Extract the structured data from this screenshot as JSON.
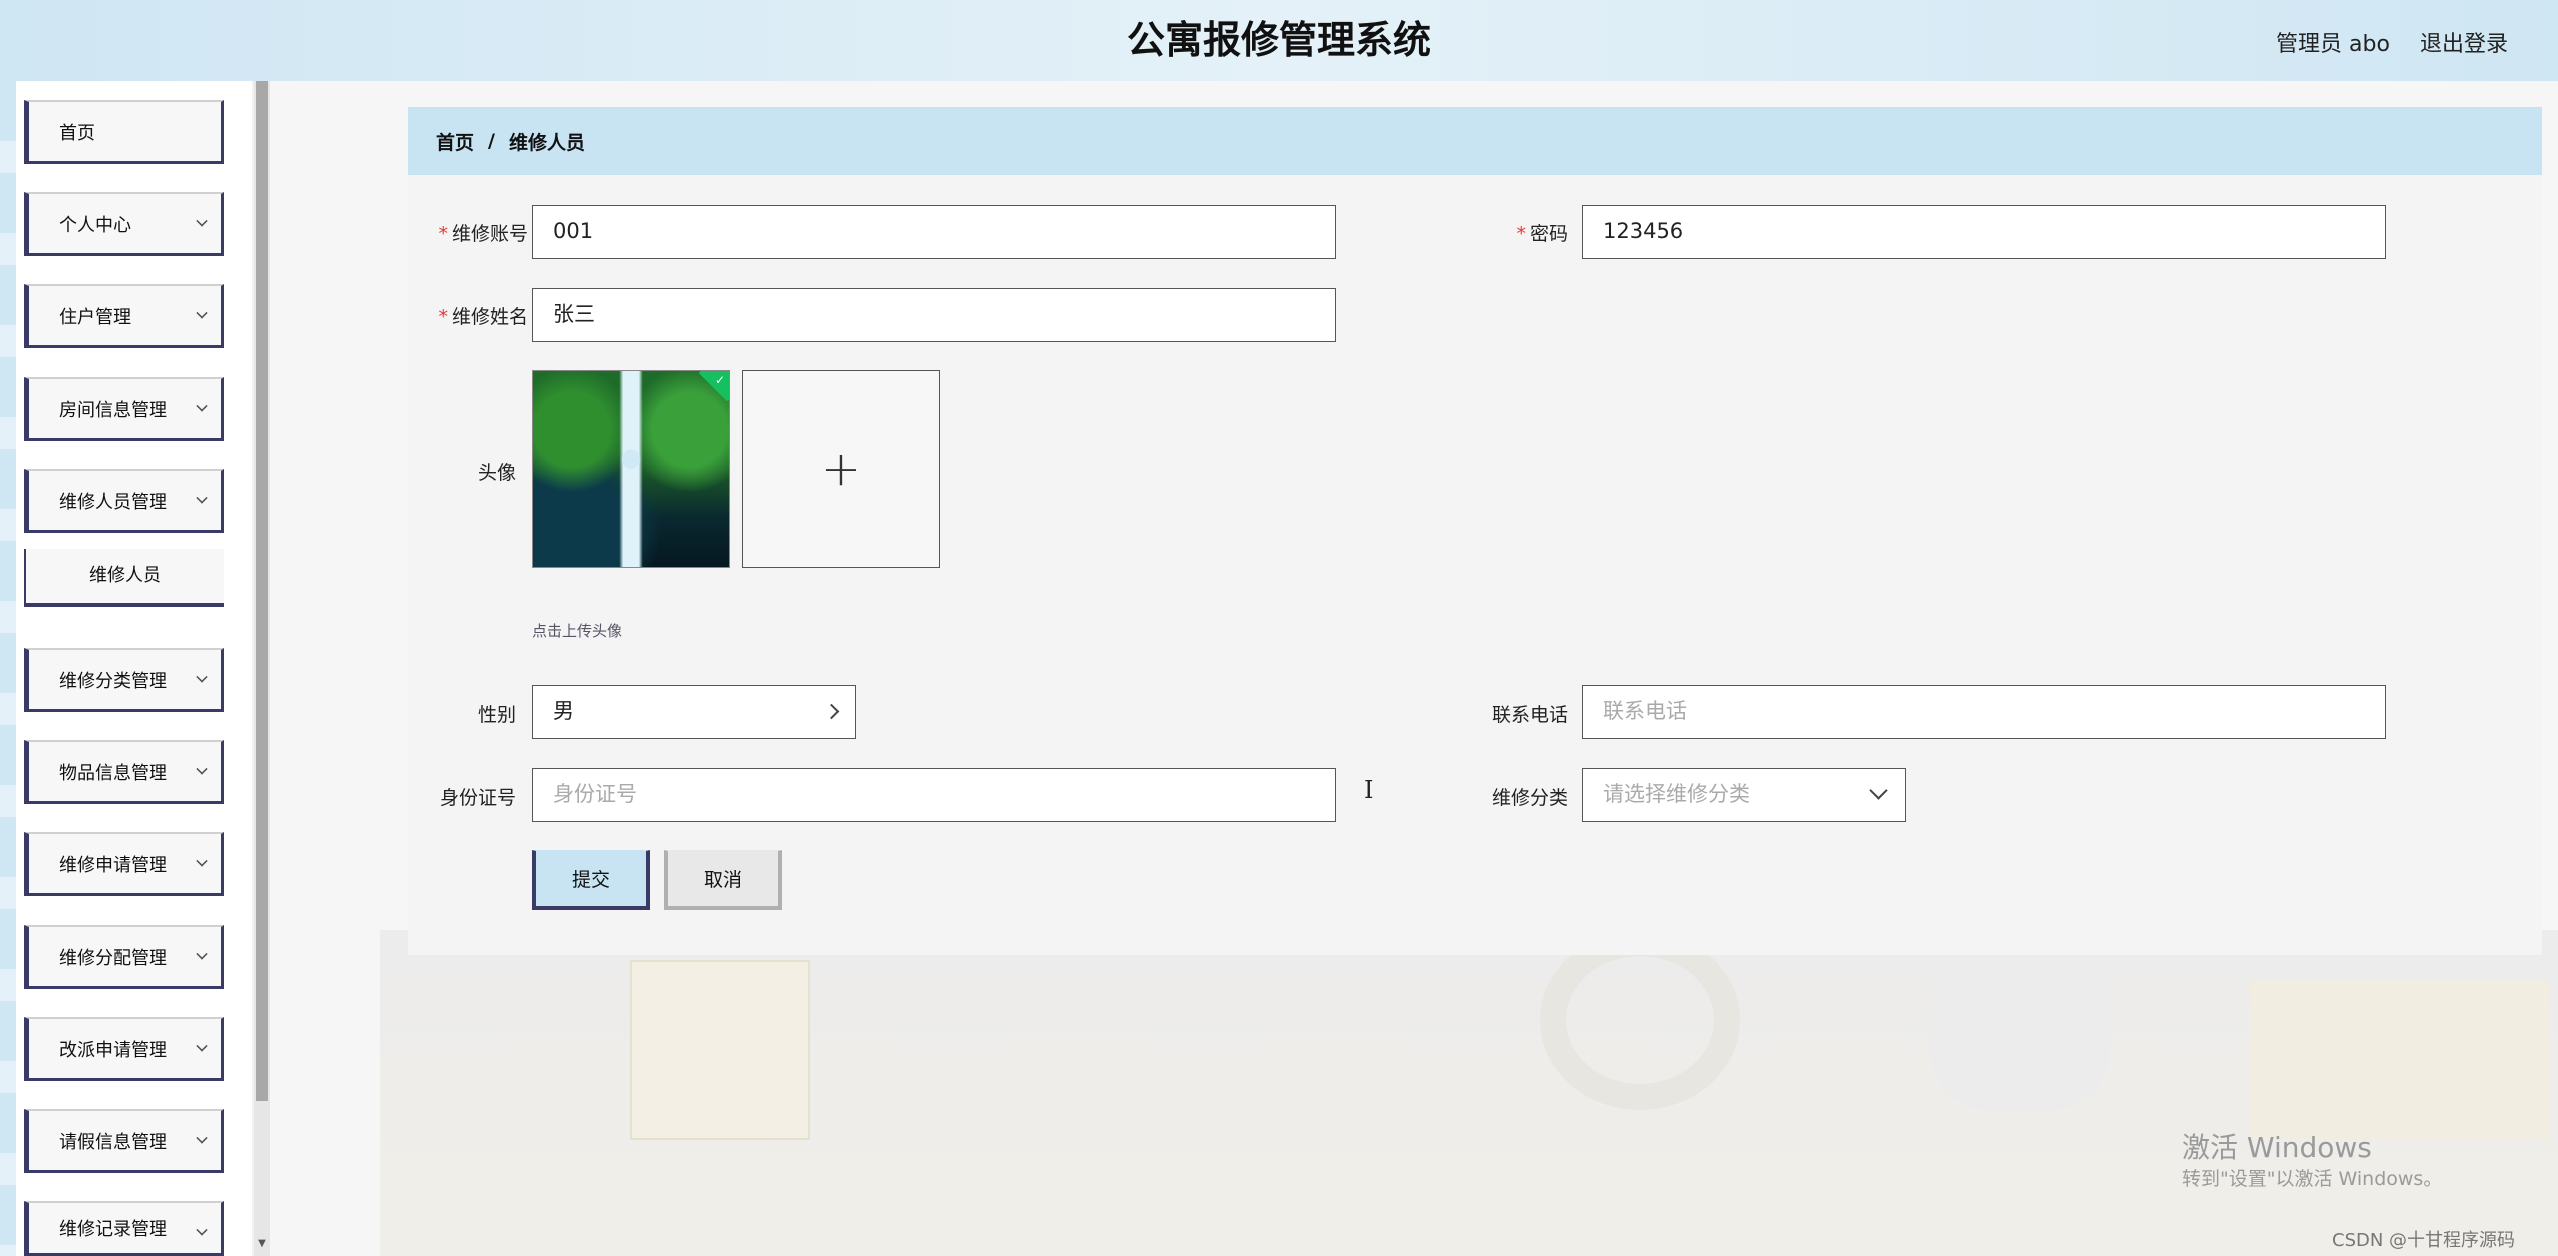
{
  "app": {
    "title": "公寓报修管理系统",
    "user_label": "管理员 abo",
    "logout": "退出登录"
  },
  "sidebar": {
    "items": [
      {
        "label": "首页"
      },
      {
        "label": "个人中心"
      },
      {
        "label": "住户管理"
      },
      {
        "label": "房间信息管理"
      },
      {
        "label": "维修人员管理"
      },
      {
        "label": "维修人员"
      },
      {
        "label": "维修分类管理"
      },
      {
        "label": "物品信息管理"
      },
      {
        "label": "维修申请管理"
      },
      {
        "label": "维修分配管理"
      },
      {
        "label": "改派申请管理"
      },
      {
        "label": "请假信息管理"
      },
      {
        "label": "维修记录管理"
      }
    ]
  },
  "breadcrumb": {
    "home": "首页",
    "separator": "/",
    "current": "维修人员"
  },
  "form": {
    "account_label": "维修账号",
    "account_value": "001",
    "password_label": "密码",
    "password_value": "123456",
    "name_label": "维修姓名",
    "name_value": "张三",
    "avatar_label": "头像",
    "upload_plus": "+",
    "upload_hint": "点击上传头像",
    "gender_label": "性别",
    "gender_value": "男",
    "phone_label": "联系电话",
    "phone_placeholder": "联系电话",
    "idcard_label": "身份证号",
    "idcard_placeholder": "身份证号",
    "category_label": "维修分类",
    "category_placeholder": "请选择维修分类",
    "required_mark": "*",
    "submit": "提交",
    "cancel": "取消"
  },
  "overlay": {
    "activate_title": "激活 Windows",
    "activate_desc": "转到\"设置\"以激活 Windows。",
    "csdn": "CSDN @十甘程序源码",
    "text_cursor": "I"
  },
  "colors": {
    "header_bg": "#cfe6f3",
    "breadcrumb_bg": "#c8e4f3",
    "menu_border": "#3a3a66",
    "required": "#e53935"
  }
}
